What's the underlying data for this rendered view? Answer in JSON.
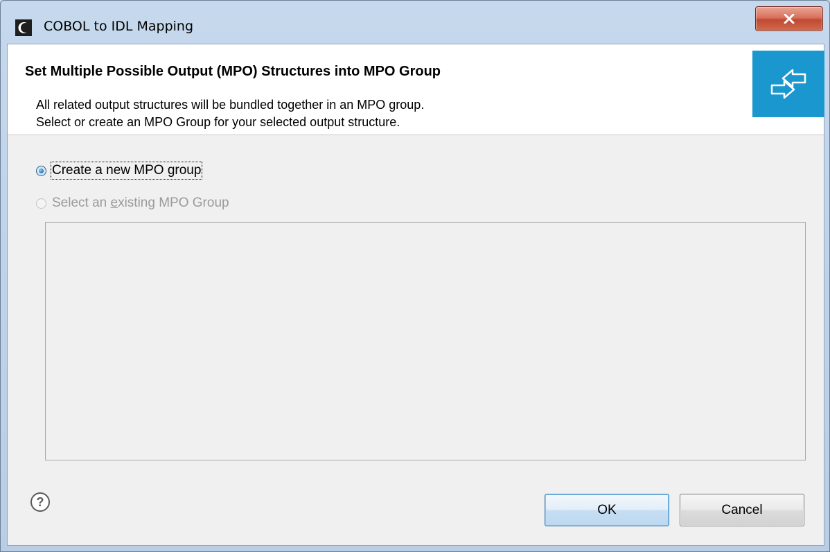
{
  "window": {
    "title": "COBOL to IDL Mapping",
    "close_glyph": "x"
  },
  "banner": {
    "title": "Set Multiple Possible Output (MPO) Structures into MPO Group",
    "description_line1": "All related output structures will be bundled together in an MPO group.",
    "description_line2": "Select or create an MPO Group for your selected output structure.",
    "icon": "mapping-arrows-icon",
    "icon_color": "#1a97cf"
  },
  "options": {
    "create_new": {
      "label": "Create a new MPO group",
      "selected": true,
      "enabled": true
    },
    "select_existing": {
      "label_prefix": "Select an ",
      "label_mnemonic": "e",
      "label_suffix": "xisting MPO Group",
      "selected": false,
      "enabled": false
    }
  },
  "group_list": {
    "items": []
  },
  "footer": {
    "help_icon": "help-icon",
    "ok_label": "OK",
    "cancel_label": "Cancel"
  }
}
